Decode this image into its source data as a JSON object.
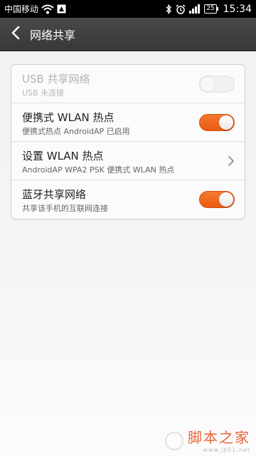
{
  "status_bar": {
    "carrier": "中国移动",
    "battery": "25",
    "time": "15:34",
    "icons": [
      "wifi-icon",
      "notification-icon",
      "bluetooth-icon",
      "alarm-icon",
      "signal-icon",
      "battery-icon"
    ]
  },
  "header": {
    "title": "网络共享",
    "back_icon": "chevron-left-icon"
  },
  "settings": [
    {
      "title": "USB 共享网络",
      "subtitle": "USB 未连接",
      "control": "toggle",
      "state": "off",
      "enabled": false
    },
    {
      "title": "便携式 WLAN 热点",
      "subtitle": "便携式热点 AndroidAP 已启用",
      "control": "toggle",
      "state": "on",
      "enabled": true
    },
    {
      "title": "设置 WLAN 热点",
      "subtitle": "AndroidAP WPA2 PSK 便携式 WLAN 热点",
      "control": "chevron",
      "enabled": true
    },
    {
      "title": "蓝牙共享网络",
      "subtitle": "共享该手机的互联网连接",
      "control": "toggle",
      "state": "on",
      "enabled": true
    }
  ],
  "watermark": {
    "brand": "脚本之家",
    "url": "www.jb51.net"
  },
  "colors": {
    "accent": "#ee6a1c",
    "title_bar": "#3f3f3f",
    "status_bar": "#000000"
  }
}
